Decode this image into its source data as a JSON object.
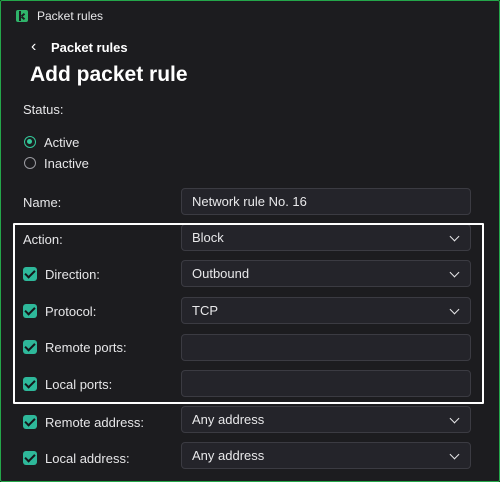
{
  "window": {
    "title": "Packet rules"
  },
  "nav": {
    "back_label": "Packet rules"
  },
  "page": {
    "heading": "Add packet rule"
  },
  "status": {
    "label": "Status:",
    "options": [
      "Active",
      "Inactive"
    ],
    "selected": "Active"
  },
  "form": {
    "name_label": "Name:",
    "name_value": "Network rule No. 16",
    "action_label": "Action:",
    "action_value": "Block",
    "direction_label": "Direction:",
    "direction_value": "Outbound",
    "protocol_label": "Protocol:",
    "protocol_value": "TCP",
    "remote_ports_label": "Remote ports:",
    "remote_ports_value": "",
    "local_ports_label": "Local ports:",
    "local_ports_value": "",
    "remote_address_label": "Remote address:",
    "remote_address_value": "Any address",
    "local_address_label": "Local address:",
    "local_address_value": "Any address"
  },
  "colors": {
    "frame_border": "#24a64a",
    "background": "#1c1c1f",
    "accent": "#2eb89a",
    "highlight_box": "#ffffff"
  },
  "icons": {
    "app": "kaspersky-app-icon",
    "back": "chevron-left-icon",
    "dropdown": "chevron-down-icon",
    "checkbox": "check-icon"
  }
}
